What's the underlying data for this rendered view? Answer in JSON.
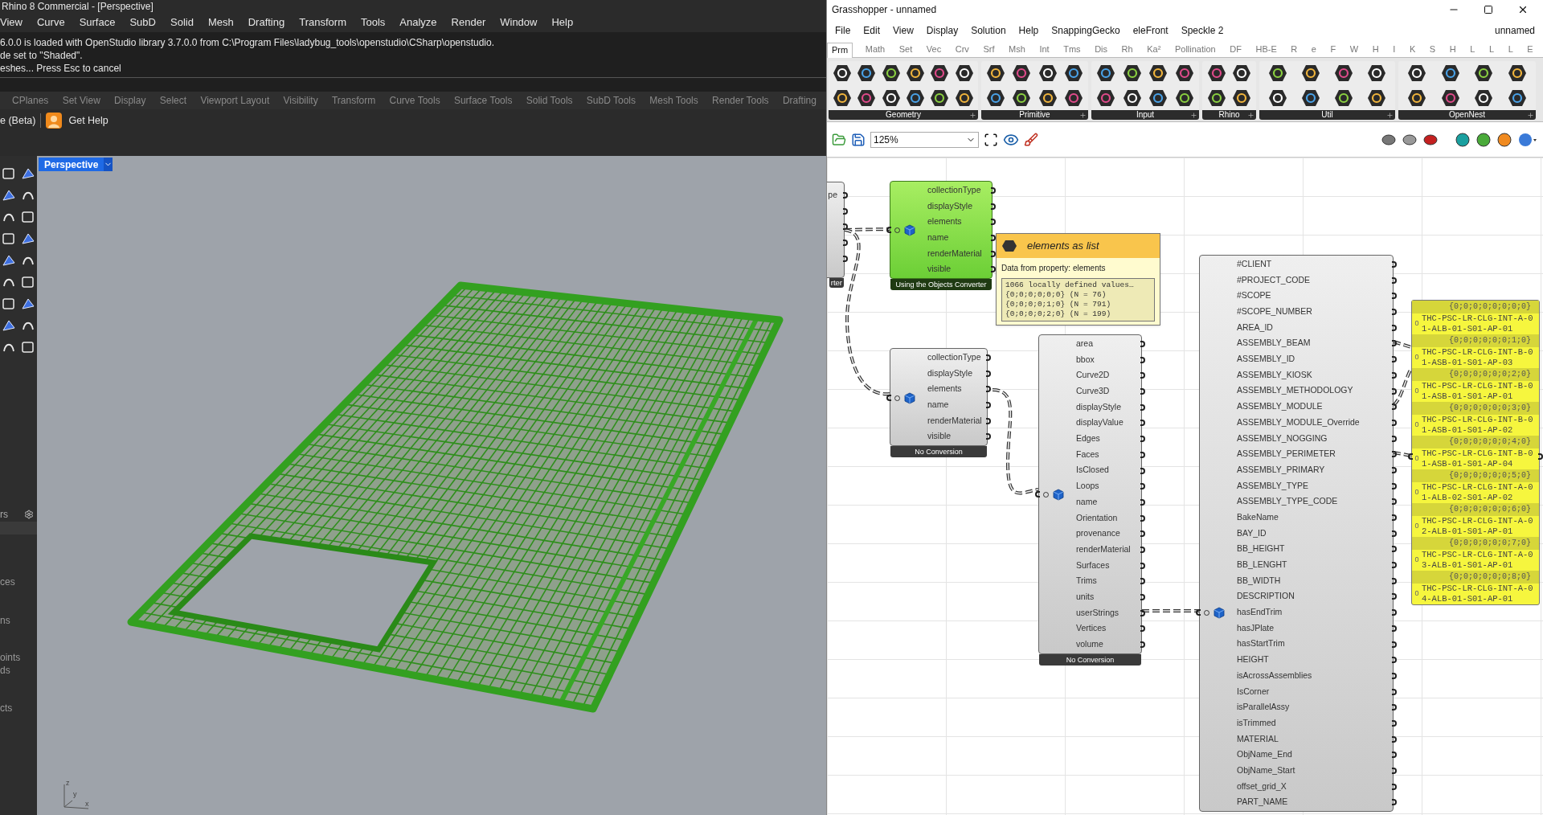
{
  "rhino": {
    "title": "Rhino 8 Commercial - [Perspective]",
    "menu": [
      "View",
      "Curve",
      "Surface",
      "SubD",
      "Solid",
      "Mesh",
      "Drafting",
      "Transform",
      "Tools",
      "Analyze",
      "Render",
      "Window",
      "Help"
    ],
    "command_history": [
      "6.0.0 is loaded with OpenStudio library 3.7.0.0 from C:\\Program Files\\ladybug_tools\\openstudio\\CSharp\\openstudio.",
      "de set to \"Shaded\".",
      "eshes... Press Esc to cancel"
    ],
    "toolbar_tabs": [
      "CPlanes",
      "Set View",
      "Display",
      "Select",
      "Viewport Layout",
      "Visibility",
      "Transform",
      "Curve Tools",
      "Surface Tools",
      "Solid Tools",
      "SubD Tools",
      "Mesh Tools",
      "Render Tools",
      "Drafting"
    ],
    "toolbar_buttons": [
      "e (Beta)",
      "Get Help"
    ],
    "side_panel": {
      "header": "rs",
      "items": [
        "ces",
        "ns",
        "oints",
        "ds",
        "cts"
      ]
    },
    "viewport": {
      "tab": "Perspective",
      "axes": [
        "z",
        "y",
        "x"
      ]
    }
  },
  "grasshopper": {
    "title": "Grasshopper - unnamed",
    "menu": [
      "File",
      "Edit",
      "View",
      "Display",
      "Solution",
      "Help",
      "SnappingGecko",
      "eleFront",
      "Speckle 2"
    ],
    "document": "unnamed",
    "tabs": [
      {
        "label": "Prm",
        "selected": true
      },
      {
        "label": "Math",
        "selected": false
      },
      {
        "label": "Set",
        "selected": false
      },
      {
        "label": "Vec",
        "selected": false
      },
      {
        "label": "Crv",
        "selected": false
      },
      {
        "label": "Srf",
        "selected": false
      },
      {
        "label": "Msh",
        "selected": false
      },
      {
        "label": "Int",
        "selected": false
      },
      {
        "label": "Tms",
        "selected": false
      },
      {
        "label": "Dis",
        "selected": false
      },
      {
        "label": "Rh",
        "selected": false
      },
      {
        "label": "Ka²",
        "selected": false
      },
      {
        "label": "Pollination",
        "selected": false
      },
      {
        "label": "DF",
        "selected": false
      },
      {
        "label": "HB-E",
        "selected": false
      },
      {
        "label": "R",
        "selected": false
      },
      {
        "label": "e",
        "selected": false
      },
      {
        "label": "F",
        "selected": false
      },
      {
        "label": "W",
        "selected": false
      },
      {
        "label": "H",
        "selected": false
      },
      {
        "label": "I",
        "selected": false
      },
      {
        "label": "K",
        "selected": false
      },
      {
        "label": "S",
        "selected": false
      },
      {
        "label": "H",
        "selected": false
      },
      {
        "label": "L",
        "selected": false
      },
      {
        "label": "L",
        "selected": false
      },
      {
        "label": "L",
        "selected": false
      },
      {
        "label": "E",
        "selected": false
      }
    ],
    "ribbon_groups": [
      "Geometry",
      "Primitive",
      "Input",
      "Rhino",
      "Util",
      "OpenNest"
    ],
    "zoom": "125%",
    "canvas": {
      "nodes": [
        {
          "kind": "partial",
          "selected": false,
          "outputs": [
            "pe"
          ],
          "footer": "rter"
        },
        {
          "kind": "component",
          "selected": true,
          "outputs": [
            "collectionType",
            "displayStyle",
            "elements",
            "name",
            "renderMaterial",
            "visible"
          ],
          "footer": "Using the Objects Converter"
        },
        {
          "kind": "component",
          "selected": false,
          "outputs": [
            "collectionType",
            "displayStyle",
            "elements",
            "name",
            "renderMaterial",
            "visible"
          ],
          "footer": "No Conversion"
        },
        {
          "kind": "component",
          "selected": false,
          "outputs": [
            "area",
            "bbox",
            "Curve2D",
            "Curve3D",
            "displayStyle",
            "displayValue",
            "Edges",
            "Faces",
            "IsClosed",
            "Loops",
            "name",
            "Orientation",
            "provenance",
            "renderMaterial",
            "Surfaces",
            "Trims",
            "units",
            "userStrings",
            "Vertices",
            "volume"
          ],
          "footer": "No Conversion"
        },
        {
          "kind": "component",
          "selected": false,
          "outputs": [
            "#CLIENT",
            "#PROJECT_CODE",
            "#SCOPE",
            "#SCOPE_NUMBER",
            "AREA_ID",
            "ASSEMBLY_BEAM",
            "ASSEMBLY_ID",
            "ASSEMBLY_KIOSK",
            "ASSEMBLY_METHODOLOGY",
            "ASSEMBLY_MODULE",
            "ASSEMBLY_MODULE_Override",
            "ASSEMBLY_NOGGING",
            "ASSEMBLY_PERIMETER",
            "ASSEMBLY_PRIMARY",
            "ASSEMBLY_TYPE",
            "ASSEMBLY_TYPE_CODE",
            "BakeName",
            "BAY_ID",
            "BB_HEIGHT",
            "BB_LENGHT",
            "BB_WIDTH",
            "DESCRIPTION",
            "hasEndTrim",
            "hasJPlate",
            "hasStartTrim",
            "HEIGHT",
            "isAcrossAssemblies",
            "IsCorner",
            "isParallelAssy",
            "isTrimmed",
            "MATERIAL",
            "ObjName_End",
            "ObjName_Start",
            "offset_grid_X",
            "PART_NAME"
          ]
        }
      ],
      "tooltip": {
        "title": "elements as list",
        "description": "Data from property: elements",
        "lines": [
          "1066 locally defined values…",
          "{0;0;0;0;0;0} (N = 76)",
          "{0;0;0;0;1;0} (N = 791)",
          "{0;0;0;0;2;0} (N = 199)"
        ]
      },
      "panel": {
        "items": [
          {
            "path": "{0;0;0;0;0;0;0;0}",
            "index": "0",
            "value": "THC-PSC-LR-CLG-INT-A-01-ALB-01-S01-AP-01"
          },
          {
            "path": "{0;0;0;0;0;0;1;0}",
            "index": "0",
            "value": "THC-PSC-LR-CLG-INT-B-01-ASB-01-S01-AP-03"
          },
          {
            "path": "{0;0;0;0;0;0;2;0}",
            "index": "0",
            "value": "THC-PSC-LR-CLG-INT-B-01-ASB-01-S01-AP-01"
          },
          {
            "path": "{0;0;0;0;0;0;3;0}",
            "index": "0",
            "value": "THC-PSC-LR-CLG-INT-B-01-ASB-01-S01-AP-02"
          },
          {
            "path": "{0;0;0;0;0;0;4;0}",
            "index": "0",
            "value": "THC-PSC-LR-CLG-INT-B-01-ASB-01-S01-AP-04"
          },
          {
            "path": "{0;0;0;0;0;0;5;0}",
            "index": "0",
            "value": "THC-PSC-LR-CLG-INT-A-01-ALB-02-S01-AP-02"
          },
          {
            "path": "{0;0;0;0;0;0;6;0}",
            "index": "0",
            "value": "THC-PSC-LR-CLG-INT-A-02-ALB-01-S01-AP-01"
          },
          {
            "path": "{0;0;0;0;0;0;7;0}",
            "index": "0",
            "value": "THC-PSC-LR-CLG-INT-A-03-ALB-01-S01-AP-01"
          },
          {
            "path": "{0;0;0;0;0;0;8;0}",
            "index": "0",
            "value": "THC-PSC-LR-CLG-INT-A-04-ALB-01-S01-AP-01"
          }
        ]
      }
    }
  }
}
